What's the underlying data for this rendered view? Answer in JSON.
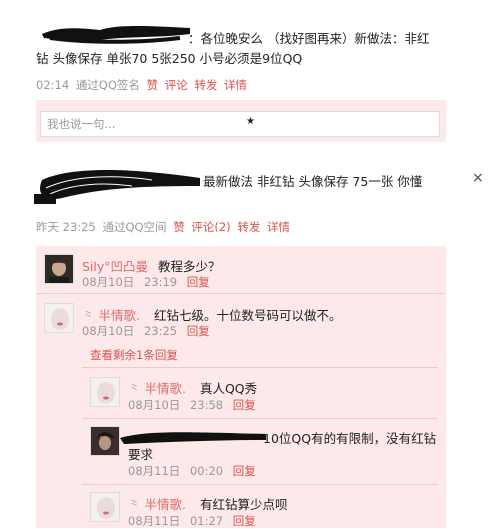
{
  "post1": {
    "text_line1": "：各位晚安么 （找好图再来）新做法：非红",
    "text_line2": "钻 头像保存 单张70 5张250 小号必须是9位QQ",
    "time": "02:14",
    "source": "通过QQ签名",
    "actions": {
      "like": "赞",
      "comment": "评论",
      "forward": "转发",
      "detail": "详情"
    },
    "comment_placeholder": "我也说一句..."
  },
  "post2": {
    "text": "最新做法 非红钻 头像保存 75一张 你懂",
    "close_glyph": "×",
    "time": "昨天 23:25",
    "source": "通过QQ空间",
    "actions": {
      "like": "赞",
      "comment": "评论(2)",
      "forward": "转发",
      "detail": "详情"
    },
    "comments": [
      {
        "name": "Sily°凹凸曼",
        "text": "教程多少？",
        "date": "08月10日",
        "time": "23:19",
        "reply": "回复"
      },
      {
        "name": "半情歌.",
        "text": "红钻七级。十位数号码可以做不。",
        "date": "08月10日",
        "time": "23:25",
        "reply": "回复",
        "view_more": "查看剩余1条回复",
        "replies": [
          {
            "name": "半情歌.",
            "text": "真人QQ秀",
            "date": "08月10日",
            "time": "23:58",
            "reply": "回复"
          },
          {
            "name": "",
            "text_line1": "10位QQ有的有限制，没有红钻",
            "text_line2": "要求",
            "date": "08月11日",
            "time": "00:20",
            "reply": "回复"
          },
          {
            "name": "半情歌.",
            "text": "有红钻算少点呗",
            "date": "08月11日",
            "time": "01:27",
            "reply": "回复"
          }
        ]
      }
    ]
  }
}
